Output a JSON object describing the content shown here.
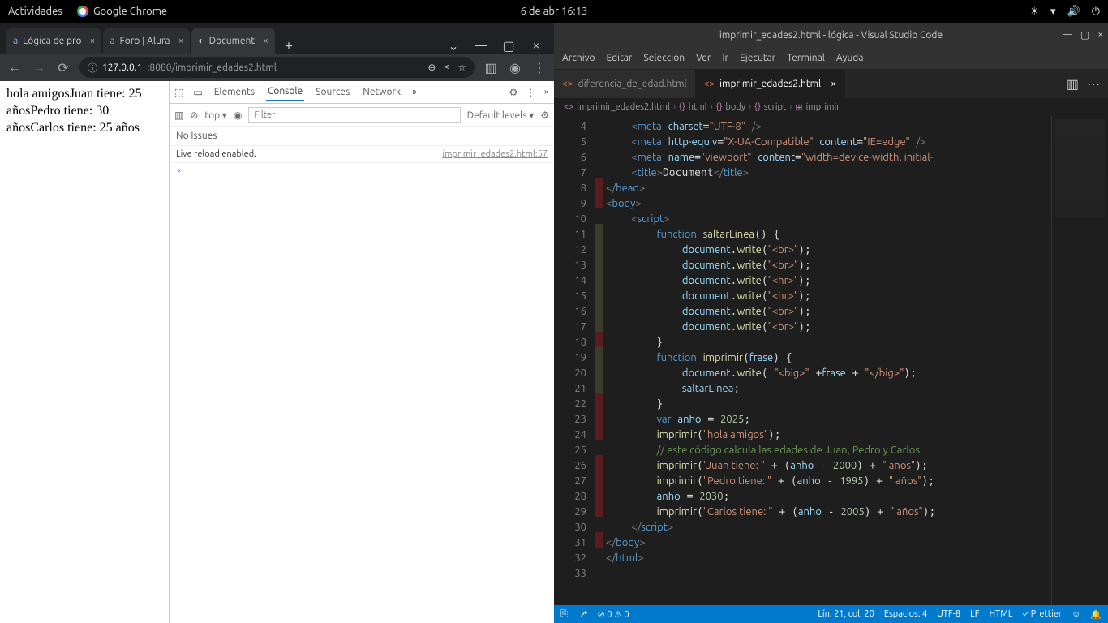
{
  "topbar": {
    "activities": "Actividades",
    "app": "Google Chrome",
    "datetime": "6 de abr  16:13"
  },
  "chrome": {
    "tabs": [
      {
        "title": "Lógica de pro"
      },
      {
        "title": "Foro | Alura"
      },
      {
        "title": "Document"
      }
    ],
    "url_prefix": "127.0.0.1",
    "url_rest": ":8080/imprimir_edades2.html",
    "page_text": "hola amigosJuan tiene: 25 añosPedro tiene: 30 añosCarlos tiene: 25 años",
    "devtools": {
      "tabs": {
        "elements": "Elements",
        "console": "Console",
        "sources": "Sources",
        "network": "Network"
      },
      "top": "top ▾",
      "filter_ph": "Filter",
      "levels": "Default levels ▾",
      "issues": "No Issues",
      "log_msg": "Live reload enabled.",
      "log_src": "imprimir_edades2.html:57"
    }
  },
  "vscode": {
    "title": "imprimir_edades2.html - lógica - Visual Studio Code",
    "menus": [
      "Archivo",
      "Editar",
      "Selección",
      "Ver",
      "Ir",
      "Ejecutar",
      "Terminal",
      "Ayuda"
    ],
    "filetabs": [
      {
        "name": "diferencia_de_edad.html"
      },
      {
        "name": "imprimir_edades2.html"
      }
    ],
    "breadcrumb": [
      "imprimir_edades2.html",
      "html",
      "body",
      "script",
      "imprimir"
    ],
    "statusbar": {
      "errors": "0",
      "warnings": "0",
      "pos": "Lín. 21, col. 20",
      "spaces": "Espacios: 4",
      "enc": "UTF-8",
      "eol": "LF",
      "lang": "HTML",
      "prettier": "Prettier"
    },
    "code_lines": [
      {
        "n": 4,
        "m": "",
        "html": "    <span class='tk-tag'>&lt;</span><span class='tk-el'>meta</span> <span class='tk-attr'>charset</span>=<span class='tk-str'>\"UTF-8\"</span> <span class='tk-tag'>/&gt;</span>"
      },
      {
        "n": 5,
        "m": "",
        "html": "    <span class='tk-tag'>&lt;</span><span class='tk-el'>meta</span> <span class='tk-attr'>http-equiv</span>=<span class='tk-str'>\"X-UA-Compatible\"</span> <span class='tk-attr'>content</span>=<span class='tk-str'>\"IE=edge\"</span> <span class='tk-tag'>/&gt;</span>"
      },
      {
        "n": 6,
        "m": "",
        "html": "    <span class='tk-tag'>&lt;</span><span class='tk-el'>meta</span> <span class='tk-attr'>name</span>=<span class='tk-str'>\"viewport\"</span> <span class='tk-attr'>content</span>=<span class='tk-str'>\"width=device-width, initial-</span>"
      },
      {
        "n": 7,
        "m": "",
        "html": "    <span class='tk-tag'>&lt;</span><span class='tk-el'>title</span><span class='tk-tag'>&gt;</span>Document<span class='tk-tag'>&lt;/</span><span class='tk-el'>title</span><span class='tk-tag'>&gt;</span>"
      },
      {
        "n": 8,
        "m": "r",
        "html": "<span class='tk-tag'>&lt;/</span><span class='tk-el'>head</span><span class='tk-tag'>&gt;</span>"
      },
      {
        "n": 9,
        "m": "r",
        "html": "<span class='tk-tag'>&lt;</span><span class='tk-el'>body</span><span class='tk-tag'>&gt;</span>"
      },
      {
        "n": 10,
        "m": "",
        "html": "    <span class='tk-tag'>&lt;</span><span class='tk-el'>script</span><span class='tk-tag'>&gt;</span>"
      },
      {
        "n": 11,
        "m": "g",
        "html": "        <span class='tk-kw'>function</span> <span class='tk-fn'>saltarLinea</span>() {"
      },
      {
        "n": 12,
        "m": "g",
        "html": "            <span class='tk-var'>document</span>.<span class='tk-fn'>write</span>(<span class='tk-str'>\"&lt;br&gt;\"</span>);"
      },
      {
        "n": 13,
        "m": "g",
        "html": "            <span class='tk-var'>document</span>.<span class='tk-fn'>write</span>(<span class='tk-str'>\"&lt;br&gt;\"</span>);"
      },
      {
        "n": 14,
        "m": "g",
        "html": "            <span class='tk-var'>document</span>.<span class='tk-fn'>write</span>(<span class='tk-str'>\"&lt;hr&gt;\"</span>);"
      },
      {
        "n": 15,
        "m": "g",
        "html": "            <span class='tk-var'>document</span>.<span class='tk-fn'>write</span>(<span class='tk-str'>\"&lt;hr&gt;\"</span>);"
      },
      {
        "n": 16,
        "m": "g",
        "html": "            <span class='tk-var'>document</span>.<span class='tk-fn'>write</span>(<span class='tk-str'>\"&lt;br&gt;\"</span>);"
      },
      {
        "n": 17,
        "m": "g",
        "html": "            <span class='tk-var'>document</span>.<span class='tk-fn'>write</span>(<span class='tk-str'>\"&lt;br&gt;\"</span>);"
      },
      {
        "n": 18,
        "m": "r",
        "html": "        }"
      },
      {
        "n": 19,
        "m": "g",
        "html": "        <span class='tk-kw'>function</span> <span class='tk-fn'>imprimir</span>(<span class='tk-var'>frase</span>) {"
      },
      {
        "n": 20,
        "m": "g",
        "html": "            <span class='tk-var'>document</span>.<span class='tk-fn'>write</span>( <span class='tk-str'>\"&lt;big&gt;\"</span> +<span class='tk-var'>frase</span> + <span class='tk-str'>\"&lt;/big&gt;\"</span>);"
      },
      {
        "n": 21,
        "m": "g",
        "html": "            <span class='tk-var'>saltarLinea</span>;"
      },
      {
        "n": 22,
        "m": "r",
        "html": "        }"
      },
      {
        "n": 23,
        "m": "r",
        "html": "        <span class='tk-kw'>var</span> <span class='tk-var'>anho</span> = <span class='tk-num'>2025</span>;"
      },
      {
        "n": 24,
        "m": "r",
        "html": "        <span class='tk-fn'>imprimir</span>(<span class='tk-str'>\"hola amigos\"</span>);"
      },
      {
        "n": 25,
        "m": "",
        "html": "        <span class='tk-cm'>// este código calcula las edades de Juan, Pedro y Carlos</span>"
      },
      {
        "n": 26,
        "m": "r",
        "html": "        <span class='tk-fn'>imprimir</span>(<span class='tk-str'>\"Juan tiene: \"</span> + (<span class='tk-var'>anho</span> - <span class='tk-num'>2000</span>) + <span class='tk-str'>\" años\"</span>);"
      },
      {
        "n": 27,
        "m": "r",
        "html": "        <span class='tk-fn'>imprimir</span>(<span class='tk-str'>\"Pedro tiene: \"</span> + (<span class='tk-var'>anho</span> - <span class='tk-num'>1995</span>) + <span class='tk-str'>\" años\"</span>);"
      },
      {
        "n": 28,
        "m": "r",
        "html": "        <span class='tk-var'>anho</span> = <span class='tk-num'>2030</span>;"
      },
      {
        "n": 29,
        "m": "r",
        "html": "        <span class='tk-fn'>imprimir</span>(<span class='tk-str'>\"Carlos tiene: \"</span> + (<span class='tk-var'>anho</span> - <span class='tk-num'>2005</span>) + <span class='tk-str'>\" años\"</span>);"
      },
      {
        "n": 30,
        "m": "",
        "html": "    <span class='tk-tag'>&lt;/</span><span class='tk-el'>script</span><span class='tk-tag'>&gt;</span>"
      },
      {
        "n": 31,
        "m": "r",
        "html": "<span class='tk-tag'>&lt;/</span><span class='tk-el'>body</span><span class='tk-tag'>&gt;</span>"
      },
      {
        "n": 32,
        "m": "",
        "html": "<span class='tk-tag'>&lt;/</span><span class='tk-el'>html</span><span class='tk-tag'>&gt;</span>"
      },
      {
        "n": 33,
        "m": "",
        "html": " "
      }
    ]
  }
}
